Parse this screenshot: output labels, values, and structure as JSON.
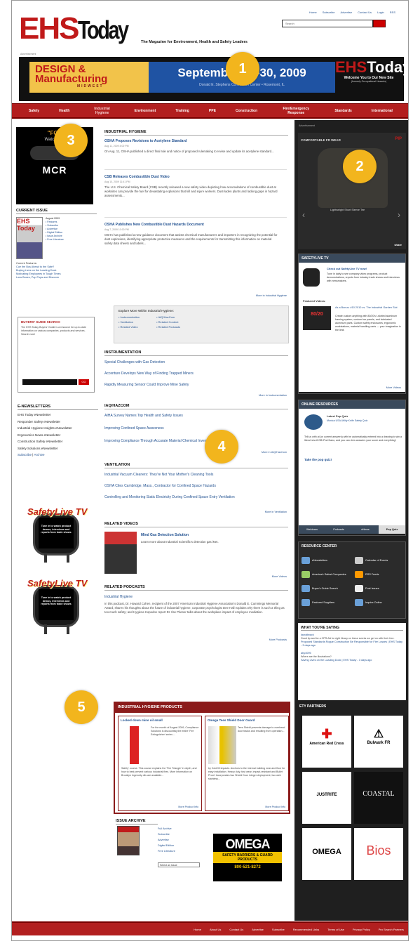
{
  "top_links": [
    "Home",
    "Subscribe",
    "Advertise",
    "Contact Us",
    "Login",
    "RSS"
  ],
  "search": {
    "placeholder": "Search"
  },
  "logo": {
    "e": "EHS",
    "t": "Today"
  },
  "tagline": "The Magazine for Environment, Health and Safety Leaders",
  "ad_label": "Advertisement",
  "banner": {
    "left_1": "DESIGN &",
    "left_2": "Manufacturing",
    "left_3": "MIDWEST",
    "mid_1": "September 29-30, 2009",
    "mid_2": "Donald E. Stephens Convention Center • Rosemont, IL",
    "right_1a": "EHS",
    "right_1b": "Today",
    "right_2": "Welcome You to Our New Site",
    "right_3": "(formerly Occupational Hazards)"
  },
  "nav": [
    "Safety",
    "Health",
    "Industrial Hygiene",
    "Environment",
    "Training",
    "PPE",
    "Construction",
    "Fire/Emergency Response",
    "Standards",
    "International"
  ],
  "left_ad": {
    "l1": "\"FOR",
    "l2": "Watch The",
    "l3": "MCR"
  },
  "current_issue": {
    "heading": "CURRENT ISSUE",
    "month": "August 2009",
    "cover_title": "EHS Today",
    "links": [
      "• Features",
      "• Subscribe",
      "• Advertise",
      "• Digital Edition",
      "• Issue Archive",
      "• Free Literature"
    ],
    "featured_label": "Current Features:",
    "featured": [
      "Cue the Bus Ahead to the Safe?",
      "Buying Lives on the Loading Dock",
      "Motivating Employees in Tough Times",
      "Loss Boxes, Pop Pops and Discover"
    ]
  },
  "buyers_guide": {
    "heading": "BUYERS' GUIDE SEARCH",
    "text": "The EHS Today Buyers' Guide is a resource for up-to-date information on various companies, products and services. Search now!",
    "go": "GO"
  },
  "enewsletters": {
    "heading": "E-NEWSLETTERS",
    "items": [
      "EHS Today eNewsletter",
      "Responder Safety eNewsletter",
      "Industrial Hygiene Insights eNewsletter",
      "Ergonomics News eNewsletter",
      "Construction Safety eNewsletter",
      "Safety Solutions eNewsletter"
    ],
    "subscribe": "Subscribe",
    "archive": "Archive"
  },
  "tv_ads": [
    {
      "logo": "SafetyLive TV",
      "text": "Tune in to watch product demos, interviews and reports from trade shows"
    },
    {
      "logo": "SafetyLive TV",
      "text": "Tune in to watch product demos, interviews and reports from trade shows"
    }
  ],
  "center": {
    "ih_heading": "INDUSTRIAL HYGIENE",
    "articles": [
      {
        "title": "OSHA Proposes Revisions to Acetylene Standard",
        "date": "Aug 11, 2009 4:00 PM",
        "text": "On Aug. 11, OSHA published a direct final rule and notice of proposed rulemaking to revise and update its acetylene standard..."
      },
      {
        "title": "CSB Releases Combustible Dust Video",
        "date": "Aug 10, 2009 11:41 PM",
        "text": "The U.S. Chemical Safety Board (CSB) recently released a new safety video depicting how accumulations of combustible dust at worksites can provide the fuel for devastating explosions that kill and injure workers. Dust-laden plants and lacking gaps in hazard assessments..."
      },
      {
        "title": "OSHA Publishes New Combustible Dust Hazards Document",
        "date": "Aug 7, 2009 10:00 PM",
        "text": "OSHA has published a new guidance document that assists chemical manufacturers and importers in recognizing the potential for dust explosions, identifying appropriate protective measures and the requirements for transmitting this information on material safety data sheets and labels..."
      }
    ],
    "more_ih": "More in Industrial Hygiene",
    "explore_heading": "Explore More Within Industrial Hygiene:",
    "explore_col1": [
      "• Instrumentation",
      "• Ventilation",
      "• Related Video"
    ],
    "explore_col2": [
      "• IAQ/HazCom",
      "• Related Content",
      "• Related Podcasts"
    ],
    "inst_heading": "INSTRUMENTATION",
    "inst": [
      "Special Challenges with Gas Detection",
      "Accenture Develops New Way of Finding Trapped Miners",
      "Rapidly Measuring Sensor Could Improve Mine Safety"
    ],
    "more_inst": "More in Instrumentation",
    "iaq_heading": "IAQ/HAZCOM",
    "iaq": [
      "AIHA Survey Names Top Health and Safety Issues",
      "Improving Confined Space Awareness",
      "Improving Compliance Through Accurate Material Chemical Inventory"
    ],
    "more_iaq": "More in IAQ/HazCom",
    "vent_heading": "VENTILATION",
    "vent": [
      "Industrial Vacuum Cleaners: They're Not Your Mother's Cleaning Tools",
      "OSHA Cites Cambridge, Mass., Contractor for Confined Space Hazards",
      "Controlling and Monitoring Static Electricity During Confined Space Entry Ventilation"
    ],
    "more_vent": "More in Ventilation",
    "video_heading": "RELATED VIDEOS",
    "video_title": "Mind Gas Detection Solution",
    "video_text": "Learn more about Industrial Scientific's detection gas iNet.",
    "more_videos": "More Videos",
    "pod_heading": "RELATED PODCASTS",
    "pod_title": "Industrial Hygiene",
    "pod_text": "In this podcast, Dr. Howard Cohen, recipient of the 2007 American Industrial Hygiene Association's Donald E. Cummings Memorial Award, shares his thoughts about the future of industrial hygiene, corporate psychologist Dee Hall explains why there is such a thing as too much safety; and Hygiene Kopodov report Dr. Ilse Plumer talks about the workplace impact of employee mediation.",
    "more_podcasts": "More Podcasts"
  },
  "ih_products": {
    "heading": "INDUSTRIAL HYGIENE PRODUCTS",
    "items": [
      {
        "title": "Locked down mine oil small",
        "text": "For the month of August 2009, Compliance Solutions is discounting the entire 'Fire Extinguisher' series ...",
        "text2": "Safety' course. This course explains the 'Fire Triangle' in depth, and how to best prevent various industrial fires. More information on Brooklyn Ingenuity oils are available...",
        "more": "More Product Info"
      },
      {
        "title": "Omega Tees Shield Door Guard",
        "text": "Tees Shield prevents damage to overhead door tracks and resulting from operation...",
        "text2": "by Cold fill impacts. Anchors to the internal building near and floor for easy installation. Heavy duty, fast wear, impact-resistant and Bullet Proof. Incorporates two Shield Door integer deployment, two web stainless...",
        "more": "More Product Info"
      }
    ]
  },
  "issue_archive": {
    "heading": "ISSUE ARCHIVE",
    "links": [
      "Full Archive",
      "Subscribe",
      "Advertise",
      "Digital Edition",
      "Free Literature"
    ],
    "select": "Select an Issue"
  },
  "omega_ad": {
    "o1": "OMEGA",
    "o2": "SAFETY BARRIERS & GUARD PRODUCTS",
    "o3": "800-521-8272"
  },
  "right": {
    "ad_label": "Advertisement",
    "ad_title": "COMFORTABLE FR WEAR",
    "ad_logo": "PIP",
    "ad_cap": "Lightweight Short Sleeve Tee",
    "share": "share",
    "stv_heading": "SAFETYLIVE TV",
    "stv_link": "Check out SafetyLive TV now!",
    "stv_text": "Tune in daily to see company video programs, product demonstrations, reports from industry trade shows and interviews with newsmakers.",
    "stv_featured": "Featured Videos:",
    "stv_vid_title": "As a Bonus: #10 2010 vs. The Industrial Garden Slot",
    "stv_vid_text": "Create custom anything with 80/20's t-slotted aluminum framing system, custom bar panels, and fabricated aluminum parts. Custom safety enclosures, ergonomic workstations, material handling carts — your imagination is the limit.",
    "stv_more": "More Videos",
    "or_heading": "ONLINE RESOURCES",
    "or_title": "Latest Pop Quiz",
    "or_sub": "Monica USA Utility Knife Safety Quiz",
    "or_text": "Tell us with at (or current answers) with be automatically entered into a drawing to win a literal new 8 GB iPod Nano, and you can view answers your score and everything!",
    "or_link": "Take the pop quiz!",
    "or_tabs": [
      "Webinars",
      "Podcasts",
      "eNews",
      "Pop Quiz"
    ],
    "rc_heading": "RESOURCE CENTER",
    "rc_items": [
      "eNewsletters",
      "America's Safest Companies",
      "Buyer's Guide Search",
      "Featured Suppliers",
      "Calendar of Events",
      "RSS Feeds",
      "Post Issues",
      "Inquire Online"
    ],
    "wys_heading": "WHAT YOU'RE SAYING",
    "wys": [
      {
        "user": "lauraliwack",
        "text": "Good tip and be a CPR-AA for right library on these events we get on with their free.",
        "link": "Proposed Standards Rogue Construction Be Responsible for Fire Losses | EHS Today - 3 days ago"
      },
      {
        "user": "aby4095",
        "text": "Where are the illustrations?",
        "link": "Saving Lives on the Loading Dock | EHS Today - 3 days ago"
      }
    ],
    "partners_heading": "ETY PARTNERS",
    "partners": [
      "American Red Cross",
      "Bulwark FR",
      "JUSTRITE",
      "COASTAL",
      "OMEGA",
      "Bios"
    ]
  },
  "footer": [
    "Home",
    "About Us",
    "Contact Us",
    "Advertise",
    "Subscribe",
    "Recommended Links",
    "Terms of Use",
    "Privacy Policy",
    "Pro Search Partners"
  ],
  "callouts": [
    "1",
    "2",
    "3",
    "4",
    "5"
  ],
  "colors": {
    "brand_red": "#b21f1f",
    "link": "#1f4f8f",
    "callout": "#f2b51d"
  }
}
